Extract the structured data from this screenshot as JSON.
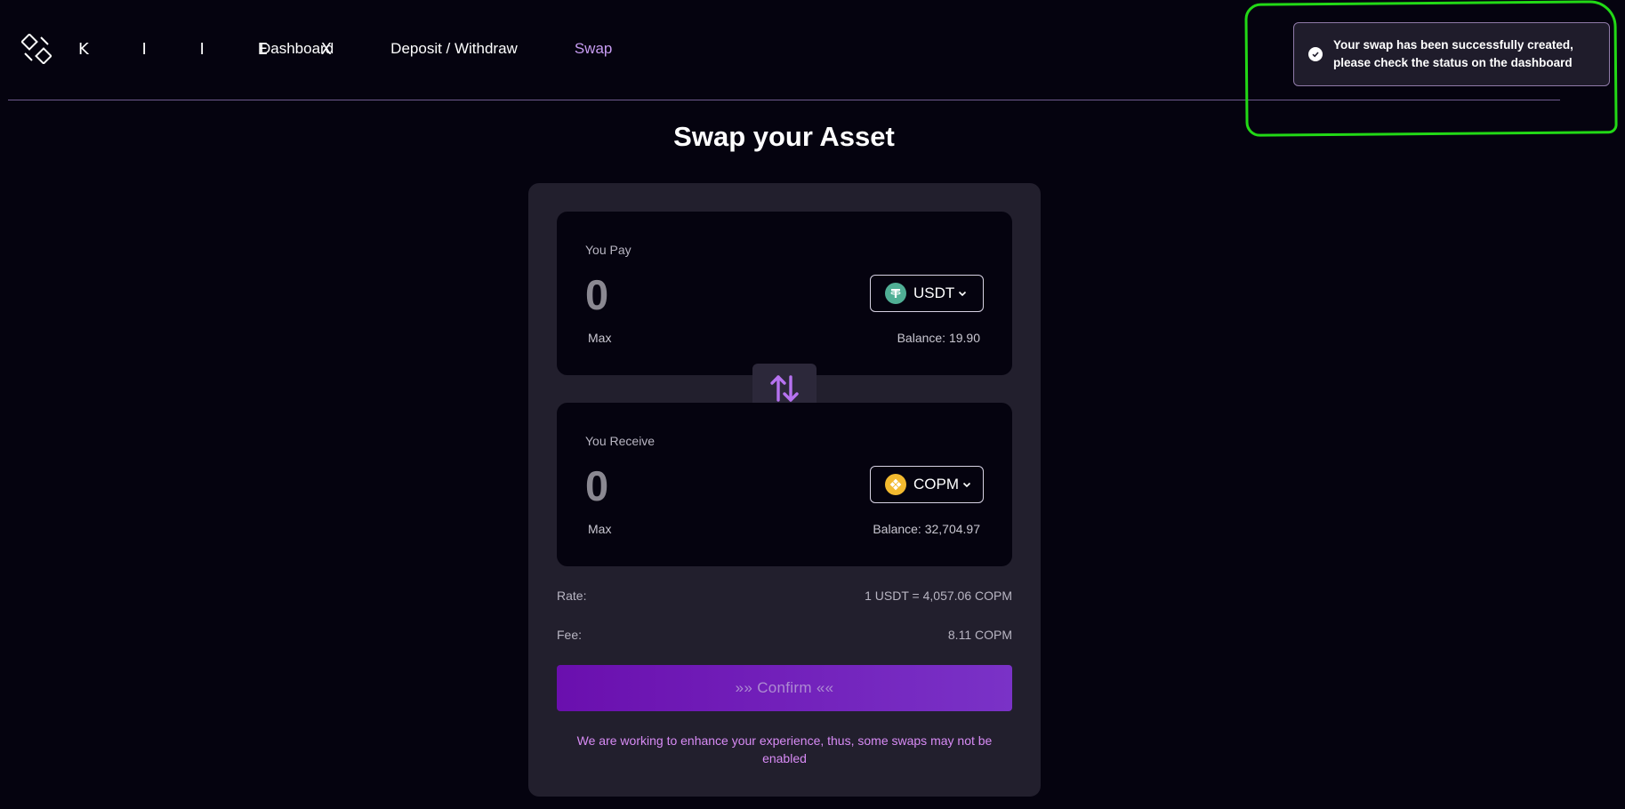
{
  "brand": {
    "name": "K I I E X",
    "accent": "#c79cf2"
  },
  "nav": {
    "items": [
      {
        "label": "Dashboard",
        "active": false
      },
      {
        "label": "Deposit / Withdraw",
        "active": false
      },
      {
        "label": "Swap",
        "active": true
      }
    ]
  },
  "toast": {
    "message": "Your swap has been successfully created, please check the status on the dashboard",
    "icon": "check-circle-icon",
    "highlight_color": "#22d916"
  },
  "page": {
    "title": "Swap your Asset"
  },
  "swap": {
    "pay": {
      "label": "You Pay",
      "amount": "0",
      "max_label": "Max",
      "token": "USDT",
      "balance": "Balance: 19.90"
    },
    "receive": {
      "label": "You Receive",
      "amount": "0",
      "max_label": "Max",
      "token": "COPM",
      "balance": "Balance: 32,704.97"
    },
    "rate_label": "Rate:",
    "rate_value": "1 USDT = 4,057.06 COPM",
    "fee_label": "Fee:",
    "fee_value": "8.11 COPM",
    "confirm_label": "»» Confirm ««",
    "notice": "We are working to enhance your experience, thus, some swaps may not be enabled"
  }
}
